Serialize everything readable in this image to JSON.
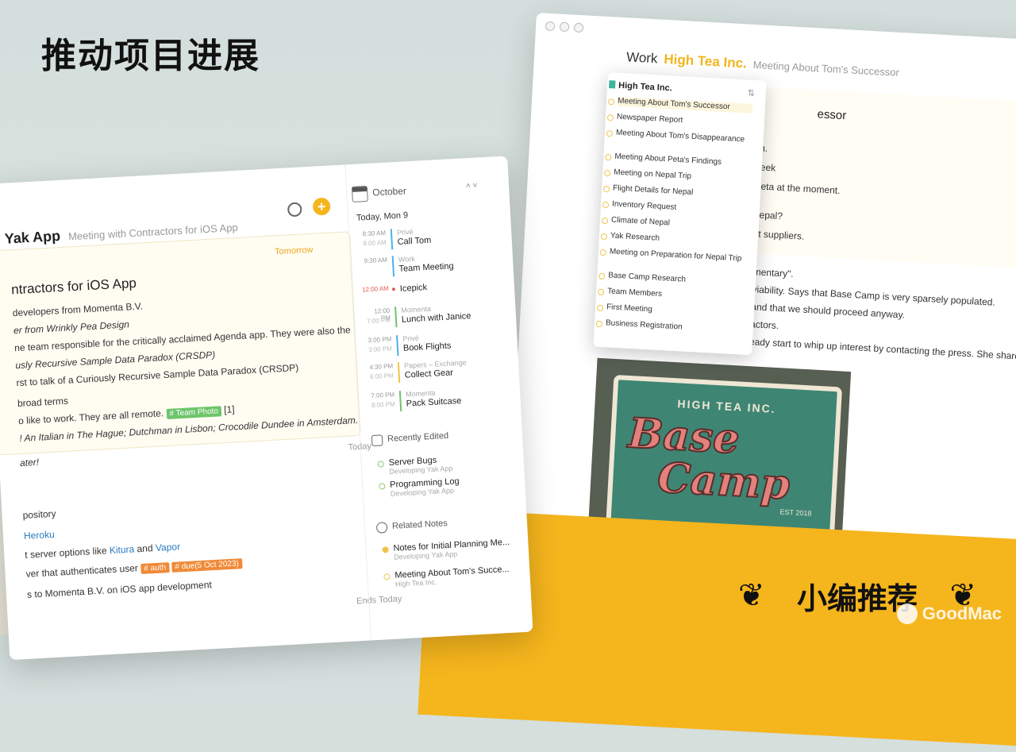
{
  "headline": "推动项目进展",
  "banner": {
    "text": "小编推荐",
    "watermark": "GoodMac"
  },
  "right_window": {
    "crumb_1": "Work",
    "crumb_2": "High Tea Inc.",
    "crumb_3": "Meeting About Tom's Successor",
    "note_title": "essor",
    "popup": {
      "header": "High Tea Inc.",
      "items": [
        "Meeting About Tom's Successor",
        "Newspaper Report",
        "Meeting About Tom's Disappearance",
        "Meeting About Peta's Findings",
        "Meeting on Nepal Trip",
        "Flight Details for Nepal",
        "Inventory Request",
        "Climate of Nepal",
        "Yak Research",
        "Meeting on Preparation for Nepal Trip",
        "Base Camp Research",
        "Team Members",
        "First Meeting",
        "Business Registration"
      ]
    },
    "lines": [
      "n.",
      "eek",
      "eta at the moment.",
      "epal?",
      "t suppliers.",
      "mentary\".",
      "viability. Says that Base Camp is very sparsely populated.",
      "and that we should proceed anyway.",
      "actors.",
      "eady start to whip up interest by contacting the press. She shared a"
    ],
    "poster": {
      "top": "HIGH TEA INC.",
      "title_1": "Base",
      "title_2": "Camp",
      "est": "EST 2018"
    }
  },
  "left_window": {
    "app_title": "Yak App",
    "note_subtitle": "Meeting with Contractors for iOS App",
    "tomorrow": "Tomorrow",
    "note_heading": "ntractors for iOS App",
    "note_lines": [
      "developers from Momenta B.V.",
      "er from Wrinkly Pea Design",
      "ne team responsible for the critically acclaimed Agenda app. They were also the",
      "usly Recursive Sample Data Paradox (CRSDP)",
      "rst to talk of a Curiously Recursive Sample Data Paradox (CRSDP)",
      "broad terms",
      "o like to work. They are all remote.",
      "! An Italian in The Hague; Dutchman in Lisbon; Crocodile Dundee in Amsterdam.",
      "ater!"
    ],
    "team_photo_tag": "# Team Photo",
    "ref": "[1]",
    "today": "Today",
    "list_lines": [
      "pository",
      "Heroku",
      "t server options like",
      "Kitura",
      "and",
      "Vapor",
      "ver that authenticates user",
      "# auth",
      "# due(5 Oct 2023)",
      "s to Momenta B.V. on iOS app development"
    ],
    "ends_today": "Ends Today",
    "sidebar": {
      "month": "October",
      "today_label": "Today, Mon 9",
      "events": [
        {
          "start": "8:30 AM",
          "end": "9:00 AM",
          "cat": "Privé",
          "name": "Call Tom",
          "color": "#4fb0e8"
        },
        {
          "start": "9:30 AM",
          "end": "",
          "cat": "Work",
          "name": "Team Meeting",
          "color": "#4fb0e8"
        },
        {
          "start": "12:00 AM",
          "end": "",
          "cat": "",
          "name": "Icepick",
          "color": "#e55c55"
        },
        {
          "start": "12:00 PM",
          "end": "7:00 PM",
          "cat": "Momenta",
          "name": "Lunch with Janice",
          "color": "#6cc56a"
        },
        {
          "start": "3:00 PM",
          "end": "3:00 PM",
          "cat": "Privé",
          "name": "Book Flights",
          "color": "#4fb0e8"
        },
        {
          "start": "4:30 PM",
          "end": "6:00 PM",
          "cat": "Papers – Exchange",
          "name": "Collect Gear",
          "color": "#f0c34a"
        },
        {
          "start": "7:00 PM",
          "end": "8:00 PM",
          "cat": "Momenta",
          "name": "Pack Suitcase",
          "color": "#6cc56a"
        }
      ],
      "recent_title": "Recently Edited",
      "recent": [
        {
          "name": "Server Bugs",
          "sub": "Developing Yak App"
        },
        {
          "name": "Programming Log",
          "sub": "Developing Yak App"
        }
      ],
      "related_title": "Related Notes",
      "related": [
        {
          "name": "Notes for Initial Planning Me...",
          "sub": "Developing Yak App"
        },
        {
          "name": "Meeting About Tom's Succe...",
          "sub": "High Tea Inc."
        }
      ]
    }
  }
}
